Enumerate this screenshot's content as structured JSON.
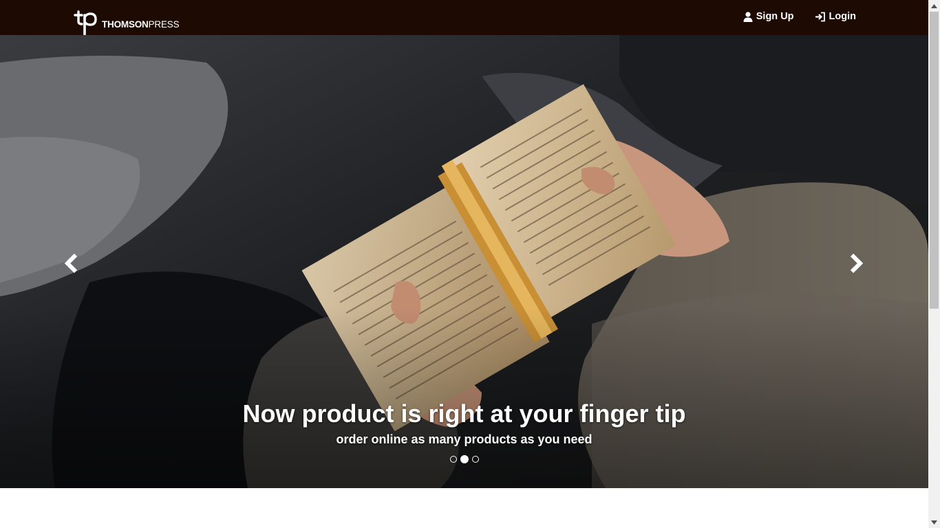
{
  "header": {
    "brand_bold": "THOMSON",
    "brand_light": "PRESS",
    "logo_icon": "tp-monogram-icon",
    "links": [
      {
        "label": "Sign Up",
        "icon": "user-icon"
      },
      {
        "label": "Login",
        "icon": "login-icon"
      }
    ]
  },
  "carousel": {
    "title": "Now product is right at your finger tip",
    "subtitle": "order online as many products as you need",
    "slide_count": 3,
    "active_index": 1,
    "prev_icon": "chevron-left-icon",
    "next_icon": "chevron-right-icon"
  },
  "colors": {
    "navbar_bg": "#1c0a03",
    "text": "#ffffff"
  }
}
